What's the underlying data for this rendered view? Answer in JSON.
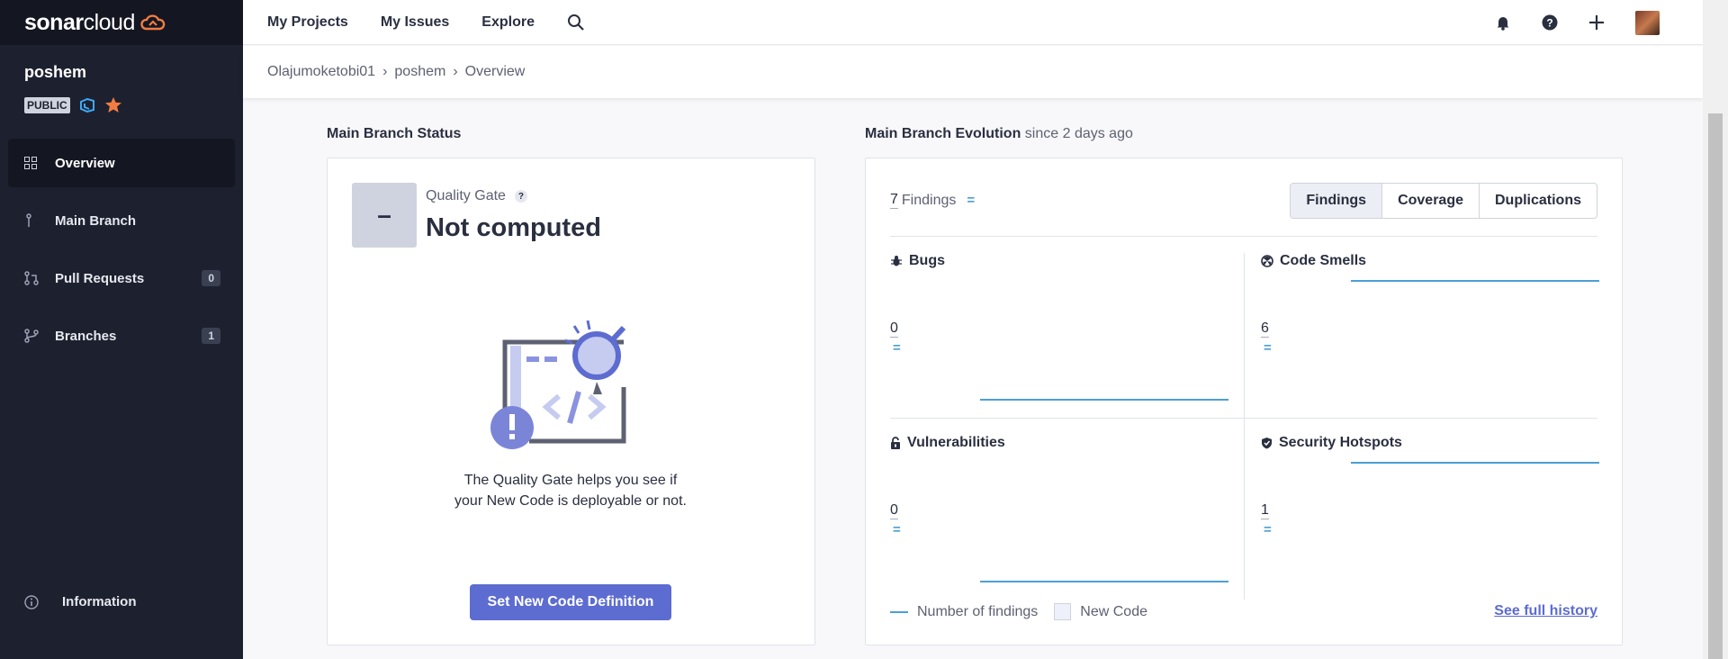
{
  "brand": {
    "name_bold": "sonar",
    "name_light": "cloud"
  },
  "project": {
    "name": "poshem",
    "visibility": "PUBLIC"
  },
  "sidebar": {
    "items": [
      {
        "label": "Overview",
        "icon": "grid-icon",
        "active": true
      },
      {
        "label": "Main Branch",
        "icon": "branch-icon"
      },
      {
        "label": "Pull Requests",
        "icon": "pull-request-icon",
        "count": "0"
      },
      {
        "label": "Branches",
        "icon": "branches-icon",
        "count": "1"
      }
    ],
    "info_label": "Information"
  },
  "topbar": {
    "nav": [
      "My Projects",
      "My Issues",
      "Explore"
    ],
    "icons": [
      "search-icon",
      "bell-icon",
      "help-icon",
      "plus-icon",
      "avatar"
    ]
  },
  "breadcrumb": [
    "Olajumoketobi01",
    "poshem",
    "Overview"
  ],
  "status": {
    "title": "Main Branch Status",
    "qg_symbol": "–",
    "qg_label": "Quality Gate",
    "qg_help": "?",
    "qg_status": "Not computed",
    "help_text": "The Quality Gate helps you see if your New Code is deployable or not.",
    "button_label": "Set New Code Definition"
  },
  "evolution": {
    "title": "Main Branch Evolution",
    "subtitle": "since 2 days ago",
    "findings_count": "7",
    "findings_label": "Findings",
    "eq": "=",
    "tabs": [
      "Findings",
      "Coverage",
      "Duplications"
    ],
    "selected_tab": "Findings",
    "metrics": [
      {
        "label": "Bugs",
        "icon": "bug-icon",
        "value": "0",
        "trend": "low"
      },
      {
        "label": "Code Smells",
        "icon": "code-smell-icon",
        "value": "6",
        "trend": "high"
      },
      {
        "label": "Vulnerabilities",
        "icon": "lock-icon",
        "value": "0",
        "trend": "low"
      },
      {
        "label": "Security Hotspots",
        "icon": "shield-icon",
        "value": "1",
        "trend": "high"
      }
    ],
    "legend_findings": "Number of findings",
    "legend_new_code": "New Code",
    "history_link": "See full history"
  },
  "colors": {
    "accent": "#5d6cd0",
    "sidebar": "#1d212f",
    "line": "#4b9fd5",
    "star": "#f27d42"
  }
}
